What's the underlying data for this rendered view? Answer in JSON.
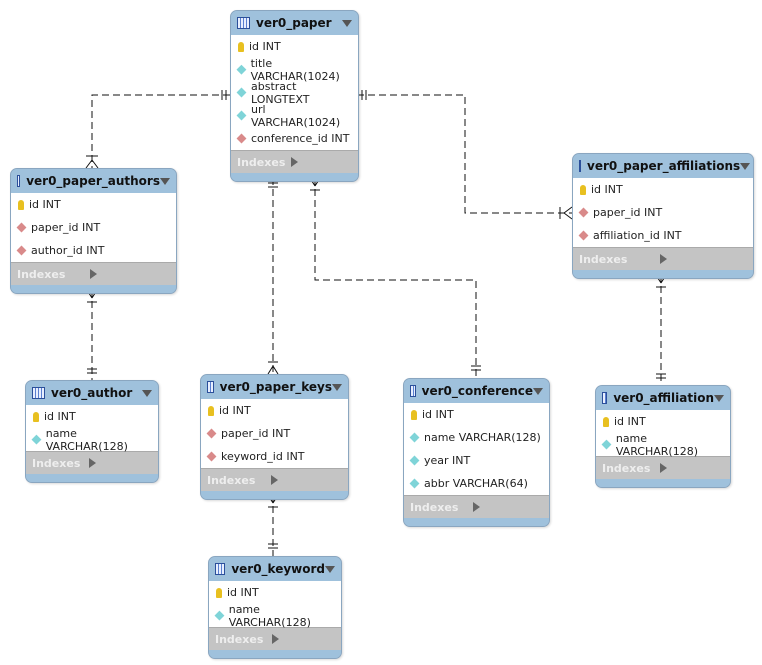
{
  "indexes_label": "Indexes",
  "colors": {
    "header": "#9fc1dc",
    "primary_key": "#e8c020",
    "column": "#7fd4d8",
    "foreign_key": "#d98a8a"
  },
  "tables": [
    {
      "name": "ver0_paper",
      "columns": [
        {
          "text": "id INT",
          "kind": "pk"
        },
        {
          "text": "title VARCHAR(1024)",
          "kind": "col"
        },
        {
          "text": "abstract LONGTEXT",
          "kind": "col"
        },
        {
          "text": "url VARCHAR(1024)",
          "kind": "col"
        },
        {
          "text": "conference_id INT",
          "kind": "fk"
        }
      ]
    },
    {
      "name": "ver0_paper_authors",
      "columns": [
        {
          "text": "id INT",
          "kind": "pk"
        },
        {
          "text": "paper_id INT",
          "kind": "fk"
        },
        {
          "text": "author_id INT",
          "kind": "fk"
        }
      ]
    },
    {
      "name": "ver0_paper_affiliations",
      "columns": [
        {
          "text": "id INT",
          "kind": "pk"
        },
        {
          "text": "paper_id INT",
          "kind": "fk"
        },
        {
          "text": "affiliation_id INT",
          "kind": "fk"
        }
      ]
    },
    {
      "name": "ver0_author",
      "columns": [
        {
          "text": "id INT",
          "kind": "pk"
        },
        {
          "text": "name VARCHAR(128)",
          "kind": "col"
        }
      ]
    },
    {
      "name": "ver0_paper_keys",
      "columns": [
        {
          "text": "id INT",
          "kind": "pk"
        },
        {
          "text": "paper_id INT",
          "kind": "fk"
        },
        {
          "text": "keyword_id INT",
          "kind": "fk"
        }
      ]
    },
    {
      "name": "ver0_conference",
      "columns": [
        {
          "text": "id INT",
          "kind": "pk"
        },
        {
          "text": "name VARCHAR(128)",
          "kind": "col"
        },
        {
          "text": "year INT",
          "kind": "col"
        },
        {
          "text": "abbr VARCHAR(64)",
          "kind": "col"
        }
      ]
    },
    {
      "name": "ver0_affiliation",
      "columns": [
        {
          "text": "id INT",
          "kind": "pk"
        },
        {
          "text": "name VARCHAR(128)",
          "kind": "col"
        }
      ]
    },
    {
      "name": "ver0_keyword",
      "columns": [
        {
          "text": "id INT",
          "kind": "pk"
        },
        {
          "text": "name VARCHAR(128)",
          "kind": "col"
        }
      ]
    }
  ],
  "relationships": [
    {
      "from": "ver0_paper",
      "to": "ver0_paper_authors",
      "cardinality": "one-to-many"
    },
    {
      "from": "ver0_paper",
      "to": "ver0_paper_affiliations",
      "cardinality": "one-to-many"
    },
    {
      "from": "ver0_paper",
      "to": "ver0_paper_keys",
      "cardinality": "one-to-many"
    },
    {
      "from": "ver0_conference",
      "to": "ver0_paper",
      "cardinality": "one-to-many"
    },
    {
      "from": "ver0_author",
      "to": "ver0_paper_authors",
      "cardinality": "one-to-many"
    },
    {
      "from": "ver0_affiliation",
      "to": "ver0_paper_affiliations",
      "cardinality": "one-to-many"
    },
    {
      "from": "ver0_keyword",
      "to": "ver0_paper_keys",
      "cardinality": "one-to-many"
    }
  ]
}
